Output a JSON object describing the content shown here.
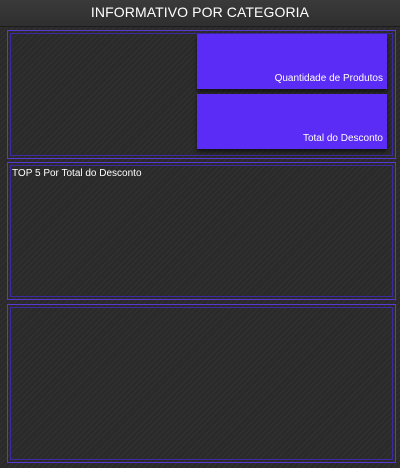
{
  "header": {
    "title": "INFORMATIVO POR CATEGORIA"
  },
  "kpis": [
    {
      "label": "Quantidade de Produtos"
    },
    {
      "label": "Total do Desconto"
    }
  ],
  "top5": {
    "title": "TOP 5 Por Total do Desconto"
  },
  "colors": {
    "accent": "#5a2cf5",
    "panel_border": "#5b37d8",
    "background": "#2a2a2a",
    "text": "#ffffff"
  }
}
